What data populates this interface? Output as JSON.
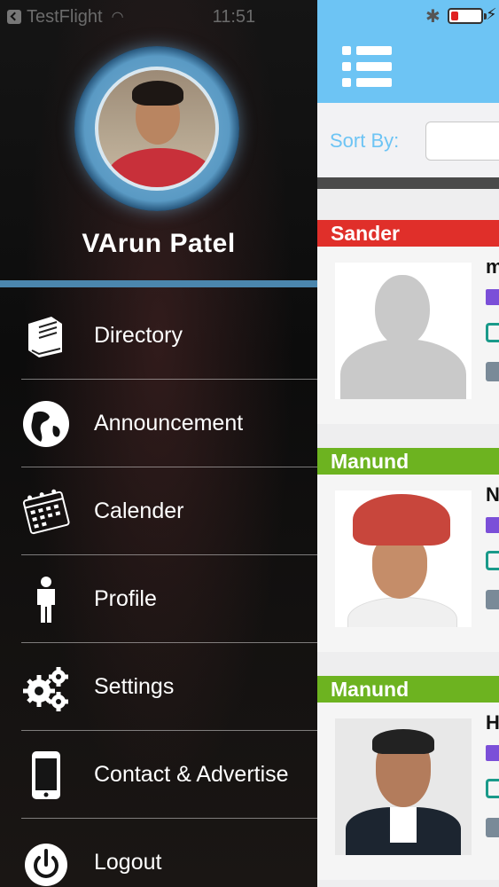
{
  "drawer": {
    "status_bar": {
      "carrier": "TestFlight",
      "time": "11:51"
    },
    "user": {
      "name": "VArun Patel"
    },
    "menu": [
      {
        "label": "Directory",
        "icon": "book-icon"
      },
      {
        "label": "Announcement",
        "icon": "globe-icon"
      },
      {
        "label": "Calender",
        "icon": "calendar-icon"
      },
      {
        "label": "Profile",
        "icon": "person-icon"
      },
      {
        "label": "Settings",
        "icon": "gears-icon"
      },
      {
        "label": "Contact & Advertise",
        "icon": "phone-icon"
      },
      {
        "label": "Logout",
        "icon": "power-icon"
      }
    ]
  },
  "main": {
    "sort": {
      "label": "Sort By:",
      "value": ""
    },
    "cards": [
      {
        "band": "Sander",
        "band_color": "#e02f2a",
        "name_initial": "m"
      },
      {
        "band": "Manund",
        "band_color": "#6db320",
        "name_initial": "N"
      },
      {
        "band": "Manund",
        "band_color": "#6db320",
        "name_initial": "H"
      }
    ]
  },
  "colors": {
    "accent_blue": "#6dc4f4",
    "drawer_divider": "#4b86ad",
    "battery_low": "#e02020"
  }
}
